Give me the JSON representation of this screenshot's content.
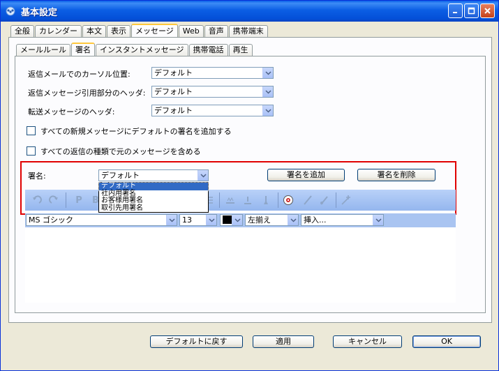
{
  "window": {
    "title": "基本設定"
  },
  "main_tabs": [
    {
      "label": "全般"
    },
    {
      "label": "カレンダー"
    },
    {
      "label": "本文"
    },
    {
      "label": "表示"
    },
    {
      "label": "メッセージ",
      "active": true
    },
    {
      "label": "Web"
    },
    {
      "label": "音声"
    },
    {
      "label": "携帯端末"
    }
  ],
  "sub_tabs": [
    {
      "label": "メールルール"
    },
    {
      "label": "署名",
      "active": true
    },
    {
      "label": "インスタントメッセージ"
    },
    {
      "label": "携帯電話"
    },
    {
      "label": "再生"
    }
  ],
  "settings": {
    "reply_cursor": {
      "label": "返信メールでのカーソル位置:",
      "value": "デフォルト"
    },
    "reply_header": {
      "label": "返信メッセージ引用部分のヘッダ:",
      "value": "デフォルト"
    },
    "forward_header": {
      "label": "転送メッセージのヘッダ:",
      "value": "デフォルト"
    },
    "add_default_sig": {
      "label": "すべての新規メッセージにデフォルトの署名を追加する",
      "checked": false
    },
    "include_original": {
      "label": "すべての返信の種類で元のメッセージを含める",
      "checked": false
    }
  },
  "signature": {
    "label": "署名:",
    "value": "デフォルト",
    "add_button": "署名を追加",
    "delete_button": "署名を削除",
    "options": [
      "デフォルト",
      "社内用署名",
      "お客様用署名",
      "取引先用署名"
    ],
    "selected_index": 0
  },
  "format": {
    "font": "MS ゴシック",
    "size": "13",
    "color": "#000000",
    "align": "左揃え",
    "insert": "挿入..."
  },
  "footer": {
    "restore_default": "デフォルトに戻す",
    "apply": "適用",
    "cancel": "キャンセル",
    "ok": "OK"
  },
  "colors": {
    "highlight_box": "#e00000",
    "title_bar": "#0a5fe8"
  }
}
